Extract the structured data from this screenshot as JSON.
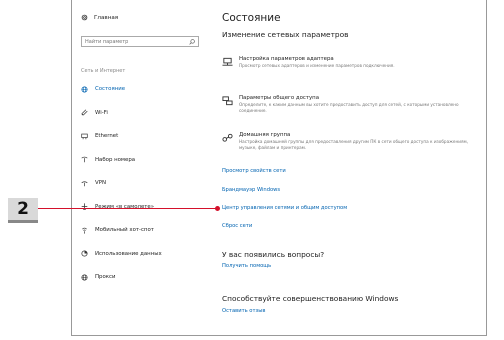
{
  "sidebar": {
    "home_label": "Главная",
    "search_placeholder": "Найти параметр",
    "section_label": "Сеть и Интернет",
    "items": [
      {
        "label": "Состояние",
        "icon": "globe-icon",
        "active": true
      },
      {
        "label": "Wi-Fi",
        "icon": "wifi-icon",
        "active": false
      },
      {
        "label": "Ethernet",
        "icon": "ethernet-icon",
        "active": false
      },
      {
        "label": "Набор номера",
        "icon": "dialup-icon",
        "active": false
      },
      {
        "label": "VPN",
        "icon": "vpn-icon",
        "active": false
      },
      {
        "label": "Режим «в самолете»",
        "icon": "airplane-icon",
        "active": false
      },
      {
        "label": "Мобильный хот-спот",
        "icon": "hotspot-icon",
        "active": false
      },
      {
        "label": "Использование данных",
        "icon": "data-usage-icon",
        "active": false
      },
      {
        "label": "Прокси",
        "icon": "proxy-globe-icon",
        "active": false
      }
    ]
  },
  "main": {
    "title": "Состояние",
    "subtitle": "Изменение сетевых параметров",
    "options": [
      {
        "title": "Настройка параметров адаптера",
        "desc": "Просмотр сетевых адаптеров и изменение параметров подключения.",
        "icon": "adapter-icon"
      },
      {
        "title": "Параметры общего доступа",
        "desc": "Определите, к каким данным вы хотите предоставить доступ для сетей, с которыми установлено соединение.",
        "icon": "sharing-icon"
      },
      {
        "title": "Домашняя группа",
        "desc": "Настройка домашней группы для предоставления другим ПК в сети общего доступа к изображениям, музыке, файлам и принтерам.",
        "icon": "homegroup-icon"
      }
    ],
    "links": [
      "Просмотр свойств сети",
      "Брандмауэр Windows",
      "Центр управления сетями и общим доступом",
      "Сброс сети"
    ],
    "questions_heading": "У вас появились вопросы?",
    "help_link": "Получить помощь",
    "improve_heading": "Способствуйте совершенствованию Windows",
    "feedback_link": "Оставить отзыв"
  },
  "callout": {
    "label": "2",
    "color": "#d4112b"
  },
  "colors": {
    "accent": "#0063b1"
  }
}
